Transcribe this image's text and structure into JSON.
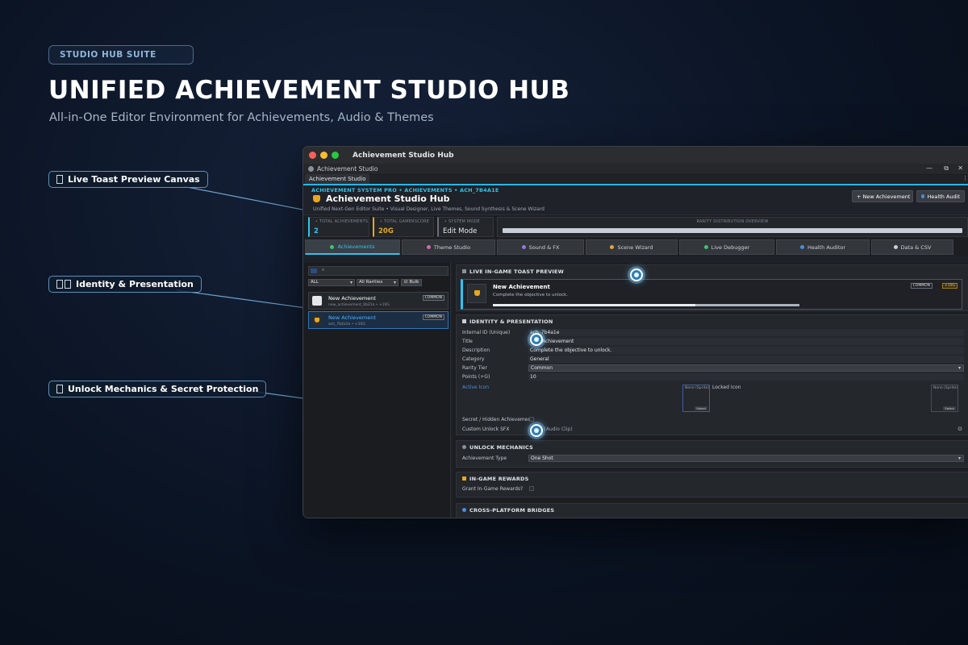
{
  "hero": {
    "badge": "STUDIO HUB SUITE",
    "title": "UNIFIED ACHIEVEMENT STUDIO HUB",
    "subtitle": "All-in-One Editor Environment for Achievements, Audio & Themes"
  },
  "callouts": {
    "toast": "Live Toast Preview Canvas",
    "identity": "Identity & Presentation",
    "unlock": "Unlock Mechanics & Secret Protection"
  },
  "window": {
    "mac_title": "Achievement Studio Hub",
    "win_title": "Achievement Studio",
    "win_controls": {
      "minimize": "—",
      "restore": "⧉",
      "close": "✕"
    },
    "doc_tab": "Achievement Studio",
    "more_menu": "⋮"
  },
  "app": {
    "breadcrumb": "ACHIEVEMENT SYSTEM PRO • ACHIEVEMENTS • ACH_7B4A1E",
    "title": "Achievement Studio Hub",
    "description": "Unified Next-Gen Editor Suite • Visual Designer, Live Themes, Sound Synthesis & Scene Wizard",
    "new_button": "+ New Achievement",
    "health_button": "Health Audit"
  },
  "stats": {
    "total_label": "• TOTAL ACHIEVEMENTS",
    "total_value": "2",
    "score_label": "• TOTAL GAMERSCORE",
    "score_value": "20G",
    "mode_label": "• SYSTEM MODE",
    "mode_value": "Edit Mode",
    "rarity_label": "RARITY DISTRIBUTION OVERVIEW"
  },
  "tabs": [
    {
      "label": "Achievements",
      "color": "#3ec46d"
    },
    {
      "label": "Theme Studio",
      "color": "#d06aa8"
    },
    {
      "label": "Sound & FX",
      "color": "#8f7ad8"
    },
    {
      "label": "Scene Wizard",
      "color": "#e8a33a"
    },
    {
      "label": "Live Debugger",
      "color": "#3ec46d"
    },
    {
      "label": "Health Auditor",
      "color": "#4a8fe0"
    },
    {
      "label": "Data & CSV",
      "color": "#c9cfd8"
    }
  ],
  "sidebar": {
    "search_placeholder": "⌕",
    "filter_all": "ALL",
    "filter_rarity": "All Rarities",
    "bulk_label": "☑ Bulk",
    "items": [
      {
        "name": "New Achievement",
        "sub": "new_achievement_0b21a • +10G",
        "tag": "COMMON"
      },
      {
        "name": "New Achievement",
        "sub": "ach_7b4a1e • +10G",
        "tag": "COMMON"
      }
    ]
  },
  "toast_panel": {
    "header": "LIVE IN-GAME TOAST PREVIEW",
    "name": "New Achievement",
    "description": "Complete the objective to unlock.",
    "rarity": "COMMON",
    "points": "+10G",
    "progress": 0.66
  },
  "identity": {
    "header": "IDENTITY & PRESENTATION",
    "fields": [
      {
        "label": "Internal ID (Unique)",
        "value": "ach_7b4a1e"
      },
      {
        "label": "Title",
        "value": "New Achievement"
      },
      {
        "label": "Description",
        "value": "Complete the objective to unlock."
      },
      {
        "label": "Category",
        "value": "General"
      },
      {
        "label": "Rarity Tier",
        "value": "Common"
      },
      {
        "label": "Points (+G)",
        "value": "10"
      }
    ],
    "active_icon_label": "Active Icon",
    "locked_icon_label": "Locked Icon",
    "icon_none": "None (Sprite)",
    "icon_select": "Select",
    "secret_label": "Secret / Hidden Achievement",
    "sfx_label": "Custom Unlock SFX",
    "sfx_value": "None (Audio Clip)",
    "sfx_picker": "⊙"
  },
  "unlock": {
    "header": "UNLOCK MECHANICS",
    "type_label": "Achievement Type",
    "type_value": "One Shot"
  },
  "rewards": {
    "header": "IN-GAME REWARDS",
    "grant_label": "Grant In-Game Rewards?"
  },
  "bridges": {
    "header": "CROSS-PLATFORM BRIDGES"
  }
}
